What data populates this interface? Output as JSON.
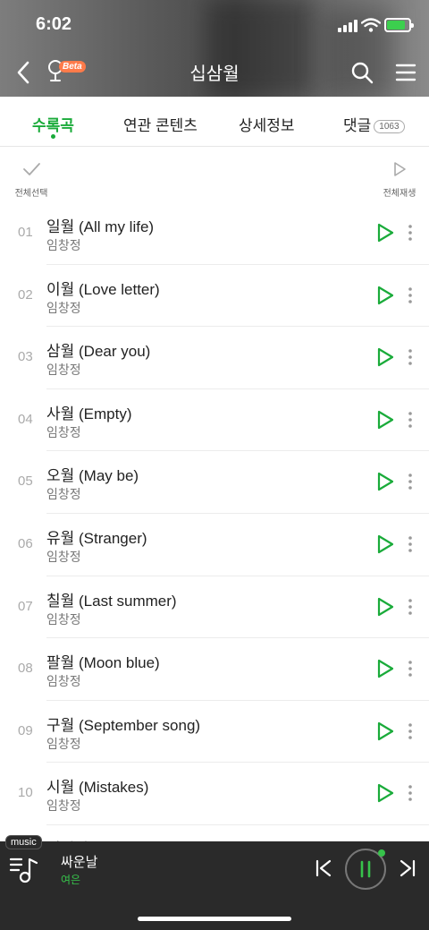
{
  "status": {
    "time": "6:02"
  },
  "nav": {
    "title": "십삼월",
    "beta_label": "Beta"
  },
  "tabs": [
    {
      "label": "수록곡",
      "active": true
    },
    {
      "label": "연관 콘텐츠",
      "active": false
    },
    {
      "label": "상세정보",
      "active": false
    },
    {
      "label": "댓글",
      "active": false,
      "count": "1063"
    }
  ],
  "toolbar": {
    "select_all_label": "전체선택",
    "play_all_label": "전체재생"
  },
  "tracks": [
    {
      "no": "01",
      "title": "일월 (All my life)",
      "artist": "임창정"
    },
    {
      "no": "02",
      "title": "이월 (Love letter)",
      "artist": "임창정"
    },
    {
      "no": "03",
      "title": "삼월 (Dear you)",
      "artist": "임창정"
    },
    {
      "no": "04",
      "title": "사월 (Empty)",
      "artist": "임창정"
    },
    {
      "no": "05",
      "title": "오월 (May be)",
      "artist": "임창정"
    },
    {
      "no": "06",
      "title": "유월 (Stranger)",
      "artist": "임창정"
    },
    {
      "no": "07",
      "title": "칠월 (Last summer)",
      "artist": "임창정"
    },
    {
      "no": "08",
      "title": "팔월 (Moon blue)",
      "artist": "임창정"
    },
    {
      "no": "09",
      "title": "구월 (September song)",
      "artist": "임창정"
    },
    {
      "no": "10",
      "title": "시월 (Mistakes)",
      "artist": "임창정"
    }
  ],
  "player": {
    "tag": "music",
    "title": "싸운날",
    "artist": "여은"
  },
  "colors": {
    "accent": "#1aab3a",
    "player_bg": "#2a2a2a",
    "player_artist": "#37c24b"
  }
}
